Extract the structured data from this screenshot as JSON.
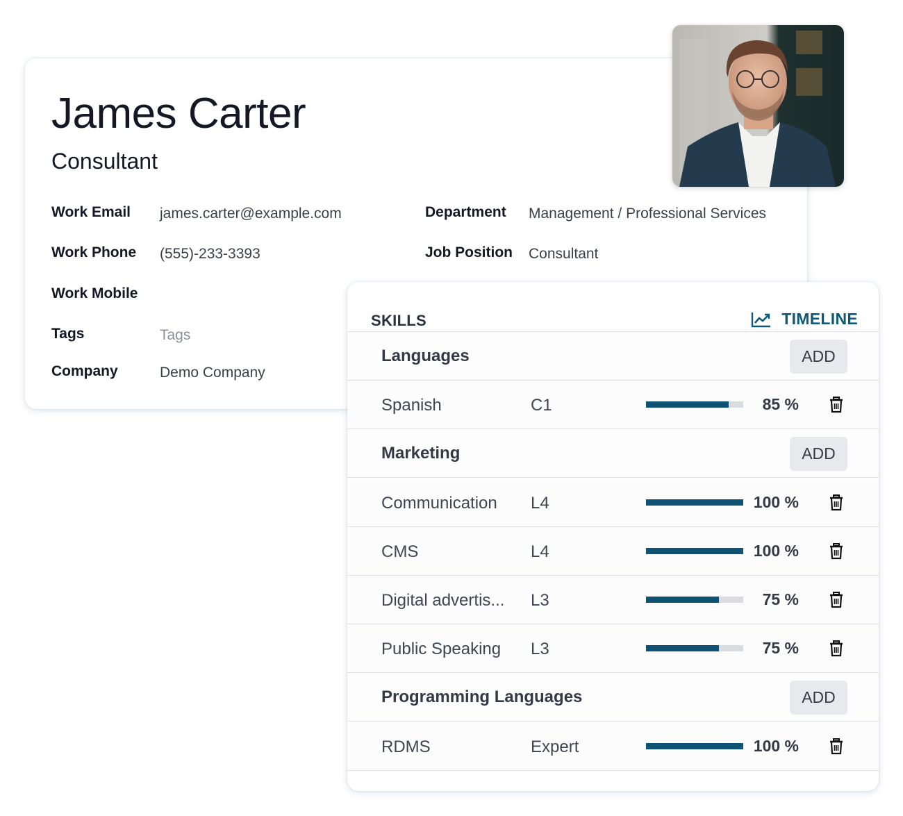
{
  "employee": {
    "name": "James Carter",
    "job_title": "Consultant",
    "fields_left": [
      {
        "label": "Work Email",
        "value": "james.carter@example.com",
        "placeholder": false
      },
      {
        "label": "Work Phone",
        "value": "(555)-233-3393",
        "placeholder": false
      },
      {
        "label": "Work Mobile",
        "value": "",
        "placeholder": false
      },
      {
        "label": "Tags",
        "value": "Tags",
        "placeholder": true
      },
      {
        "label": "Company",
        "value": "Demo Company",
        "placeholder": false
      }
    ],
    "fields_right": [
      {
        "label": "Department",
        "value": "Management / Professional Services"
      },
      {
        "label": "Job Position",
        "value": "Consultant"
      }
    ],
    "photo_alt": "employee-photo"
  },
  "skills_panel": {
    "title": "SKILLS",
    "timeline_label": "TIMELINE",
    "timeline_icon": "line-chart-icon",
    "add_label": "ADD",
    "accent_color": "#0e5373",
    "groups": [
      {
        "name": "Languages",
        "skills": [
          {
            "name": "Spanish",
            "level": "C1",
            "progress": 85,
            "progress_label": "85 %"
          }
        ]
      },
      {
        "name": "Marketing",
        "skills": [
          {
            "name": "Communication",
            "level": "L4",
            "progress": 100,
            "progress_label": "100 %"
          },
          {
            "name": "CMS",
            "level": "L4",
            "progress": 100,
            "progress_label": "100 %"
          },
          {
            "name": "Digital advertis...",
            "level": "L3",
            "progress": 75,
            "progress_label": "75 %"
          },
          {
            "name": "Public Speaking",
            "level": "L3",
            "progress": 75,
            "progress_label": "75 %"
          }
        ]
      },
      {
        "name": "Programming Languages",
        "skills": [
          {
            "name": "RDMS",
            "level": "Expert",
            "progress": 100,
            "progress_label": "100 %"
          }
        ]
      }
    ]
  }
}
